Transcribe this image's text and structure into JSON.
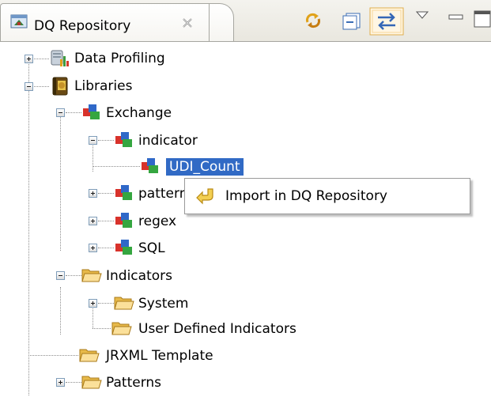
{
  "view": {
    "title": "DQ Repository",
    "close_icon": "close-icon",
    "toolbar": [
      {
        "name": "sync-icon"
      },
      {
        "name": "collapse-all-icon"
      },
      {
        "name": "link-with-editor-icon",
        "pressed": true
      },
      {
        "name": "view-menu-icon"
      },
      {
        "name": "minimize-icon"
      },
      {
        "name": "maximize-icon"
      }
    ]
  },
  "tree": {
    "nodes": [
      {
        "label": "Data Profiling",
        "icon": "data-profiling-icon",
        "expander": "plus"
      },
      {
        "label": "Libraries",
        "icon": "libraries-book-icon",
        "expander": "minus"
      },
      {
        "label": "Exchange",
        "icon": "exchange-icon",
        "expander": "minus"
      },
      {
        "label": "indicator",
        "icon": "exchange-icon",
        "expander": "minus"
      },
      {
        "label": "UDI_Count",
        "icon": "exchange-icon",
        "expander": "none",
        "selected": true
      },
      {
        "label": "patterns",
        "icon": "exchange-icon",
        "expander": "plus"
      },
      {
        "label": "regex",
        "icon": "exchange-icon",
        "expander": "plus"
      },
      {
        "label": "SQL",
        "icon": "exchange-icon",
        "expander": "plus"
      },
      {
        "label": "Indicators",
        "icon": "folder-icon",
        "expander": "minus"
      },
      {
        "label": "System",
        "icon": "folder-icon",
        "expander": "plus"
      },
      {
        "label": "User Defined Indicators",
        "icon": "folder-icon",
        "expander": "none"
      },
      {
        "label": "JRXML Template",
        "icon": "folder-icon",
        "expander": "none"
      },
      {
        "label": "Patterns",
        "icon": "folder-icon",
        "expander": "plus"
      }
    ]
  },
  "context_menu": {
    "items": [
      {
        "label": "Import in DQ Repository",
        "icon": "import-icon"
      }
    ]
  },
  "colors": {
    "selection": "#316ac5",
    "folder": "#f4c862",
    "exchange_red": "#d8322b",
    "exchange_blue": "#2f68c8",
    "exchange_green": "#35a640"
  }
}
